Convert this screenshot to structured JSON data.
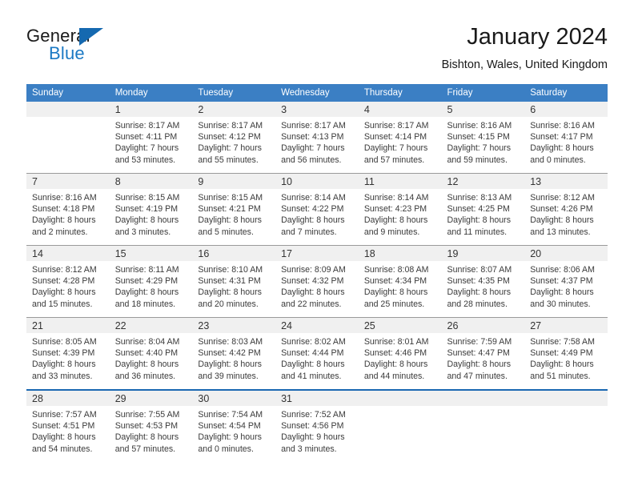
{
  "brand": {
    "name_part1": "General",
    "name_part2": "Blue",
    "triangle_color": "#1569B0",
    "blue_color": "#1B79C4"
  },
  "header": {
    "title": "January 2024",
    "subtitle": "Bishton, Wales, United Kingdom"
  },
  "calendar": {
    "header_bg": "#3B7FC4",
    "header_text_color": "#FFFFFF",
    "daynum_bg": "#F0F0F0",
    "weekday_headers": [
      "Sunday",
      "Monday",
      "Tuesday",
      "Wednesday",
      "Thursday",
      "Friday",
      "Saturday"
    ],
    "weeks": [
      [
        {
          "day": "",
          "empty": true,
          "sunrise": "",
          "sunset": "",
          "daylight_line1": "",
          "daylight_line2": ""
        },
        {
          "day": "1",
          "sunrise": "Sunrise: 8:17 AM",
          "sunset": "Sunset: 4:11 PM",
          "daylight_line1": "Daylight: 7 hours",
          "daylight_line2": "and 53 minutes."
        },
        {
          "day": "2",
          "sunrise": "Sunrise: 8:17 AM",
          "sunset": "Sunset: 4:12 PM",
          "daylight_line1": "Daylight: 7 hours",
          "daylight_line2": "and 55 minutes."
        },
        {
          "day": "3",
          "sunrise": "Sunrise: 8:17 AM",
          "sunset": "Sunset: 4:13 PM",
          "daylight_line1": "Daylight: 7 hours",
          "daylight_line2": "and 56 minutes."
        },
        {
          "day": "4",
          "sunrise": "Sunrise: 8:17 AM",
          "sunset": "Sunset: 4:14 PM",
          "daylight_line1": "Daylight: 7 hours",
          "daylight_line2": "and 57 minutes."
        },
        {
          "day": "5",
          "sunrise": "Sunrise: 8:16 AM",
          "sunset": "Sunset: 4:15 PM",
          "daylight_line1": "Daylight: 7 hours",
          "daylight_line2": "and 59 minutes."
        },
        {
          "day": "6",
          "sunrise": "Sunrise: 8:16 AM",
          "sunset": "Sunset: 4:17 PM",
          "daylight_line1": "Daylight: 8 hours",
          "daylight_line2": "and 0 minutes."
        }
      ],
      [
        {
          "day": "7",
          "sunrise": "Sunrise: 8:16 AM",
          "sunset": "Sunset: 4:18 PM",
          "daylight_line1": "Daylight: 8 hours",
          "daylight_line2": "and 2 minutes."
        },
        {
          "day": "8",
          "sunrise": "Sunrise: 8:15 AM",
          "sunset": "Sunset: 4:19 PM",
          "daylight_line1": "Daylight: 8 hours",
          "daylight_line2": "and 3 minutes."
        },
        {
          "day": "9",
          "sunrise": "Sunrise: 8:15 AM",
          "sunset": "Sunset: 4:21 PM",
          "daylight_line1": "Daylight: 8 hours",
          "daylight_line2": "and 5 minutes."
        },
        {
          "day": "10",
          "sunrise": "Sunrise: 8:14 AM",
          "sunset": "Sunset: 4:22 PM",
          "daylight_line1": "Daylight: 8 hours",
          "daylight_line2": "and 7 minutes."
        },
        {
          "day": "11",
          "sunrise": "Sunrise: 8:14 AM",
          "sunset": "Sunset: 4:23 PM",
          "daylight_line1": "Daylight: 8 hours",
          "daylight_line2": "and 9 minutes."
        },
        {
          "day": "12",
          "sunrise": "Sunrise: 8:13 AM",
          "sunset": "Sunset: 4:25 PM",
          "daylight_line1": "Daylight: 8 hours",
          "daylight_line2": "and 11 minutes."
        },
        {
          "day": "13",
          "sunrise": "Sunrise: 8:12 AM",
          "sunset": "Sunset: 4:26 PM",
          "daylight_line1": "Daylight: 8 hours",
          "daylight_line2": "and 13 minutes."
        }
      ],
      [
        {
          "day": "14",
          "sunrise": "Sunrise: 8:12 AM",
          "sunset": "Sunset: 4:28 PM",
          "daylight_line1": "Daylight: 8 hours",
          "daylight_line2": "and 15 minutes."
        },
        {
          "day": "15",
          "sunrise": "Sunrise: 8:11 AM",
          "sunset": "Sunset: 4:29 PM",
          "daylight_line1": "Daylight: 8 hours",
          "daylight_line2": "and 18 minutes."
        },
        {
          "day": "16",
          "sunrise": "Sunrise: 8:10 AM",
          "sunset": "Sunset: 4:31 PM",
          "daylight_line1": "Daylight: 8 hours",
          "daylight_line2": "and 20 minutes."
        },
        {
          "day": "17",
          "sunrise": "Sunrise: 8:09 AM",
          "sunset": "Sunset: 4:32 PM",
          "daylight_line1": "Daylight: 8 hours",
          "daylight_line2": "and 22 minutes."
        },
        {
          "day": "18",
          "sunrise": "Sunrise: 8:08 AM",
          "sunset": "Sunset: 4:34 PM",
          "daylight_line1": "Daylight: 8 hours",
          "daylight_line2": "and 25 minutes."
        },
        {
          "day": "19",
          "sunrise": "Sunrise: 8:07 AM",
          "sunset": "Sunset: 4:35 PM",
          "daylight_line1": "Daylight: 8 hours",
          "daylight_line2": "and 28 minutes."
        },
        {
          "day": "20",
          "sunrise": "Sunrise: 8:06 AM",
          "sunset": "Sunset: 4:37 PM",
          "daylight_line1": "Daylight: 8 hours",
          "daylight_line2": "and 30 minutes."
        }
      ],
      [
        {
          "day": "21",
          "sunrise": "Sunrise: 8:05 AM",
          "sunset": "Sunset: 4:39 PM",
          "daylight_line1": "Daylight: 8 hours",
          "daylight_line2": "and 33 minutes."
        },
        {
          "day": "22",
          "sunrise": "Sunrise: 8:04 AM",
          "sunset": "Sunset: 4:40 PM",
          "daylight_line1": "Daylight: 8 hours",
          "daylight_line2": "and 36 minutes."
        },
        {
          "day": "23",
          "sunrise": "Sunrise: 8:03 AM",
          "sunset": "Sunset: 4:42 PM",
          "daylight_line1": "Daylight: 8 hours",
          "daylight_line2": "and 39 minutes."
        },
        {
          "day": "24",
          "sunrise": "Sunrise: 8:02 AM",
          "sunset": "Sunset: 4:44 PM",
          "daylight_line1": "Daylight: 8 hours",
          "daylight_line2": "and 41 minutes."
        },
        {
          "day": "25",
          "sunrise": "Sunrise: 8:01 AM",
          "sunset": "Sunset: 4:46 PM",
          "daylight_line1": "Daylight: 8 hours",
          "daylight_line2": "and 44 minutes."
        },
        {
          "day": "26",
          "sunrise": "Sunrise: 7:59 AM",
          "sunset": "Sunset: 4:47 PM",
          "daylight_line1": "Daylight: 8 hours",
          "daylight_line2": "and 47 minutes."
        },
        {
          "day": "27",
          "sunrise": "Sunrise: 7:58 AM",
          "sunset": "Sunset: 4:49 PM",
          "daylight_line1": "Daylight: 8 hours",
          "daylight_line2": "and 51 minutes."
        }
      ],
      [
        {
          "day": "28",
          "sunrise": "Sunrise: 7:57 AM",
          "sunset": "Sunset: 4:51 PM",
          "daylight_line1": "Daylight: 8 hours",
          "daylight_line2": "and 54 minutes."
        },
        {
          "day": "29",
          "sunrise": "Sunrise: 7:55 AM",
          "sunset": "Sunset: 4:53 PM",
          "daylight_line1": "Daylight: 8 hours",
          "daylight_line2": "and 57 minutes."
        },
        {
          "day": "30",
          "sunrise": "Sunrise: 7:54 AM",
          "sunset": "Sunset: 4:54 PM",
          "daylight_line1": "Daylight: 9 hours",
          "daylight_line2": "and 0 minutes."
        },
        {
          "day": "31",
          "sunrise": "Sunrise: 7:52 AM",
          "sunset": "Sunset: 4:56 PM",
          "daylight_line1": "Daylight: 9 hours",
          "daylight_line2": "and 3 minutes."
        },
        {
          "day": "",
          "empty": true,
          "sunrise": "",
          "sunset": "",
          "daylight_line1": "",
          "daylight_line2": ""
        },
        {
          "day": "",
          "empty": true,
          "sunrise": "",
          "sunset": "",
          "daylight_line1": "",
          "daylight_line2": ""
        },
        {
          "day": "",
          "empty": true,
          "sunrise": "",
          "sunset": "",
          "daylight_line1": "",
          "daylight_line2": ""
        }
      ]
    ]
  }
}
